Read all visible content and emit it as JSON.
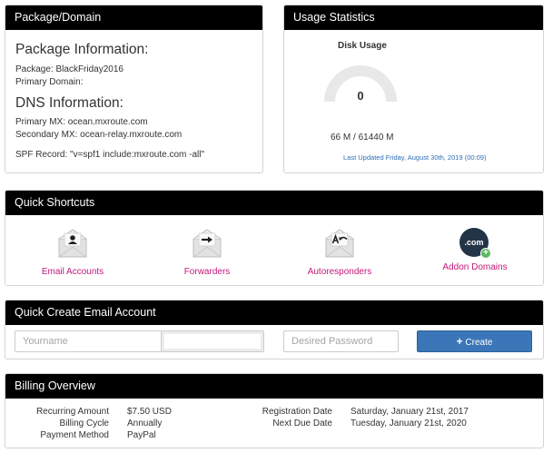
{
  "package_panel": {
    "title": "Package/Domain",
    "package_info_heading": "Package Information:",
    "package_label": "Package:",
    "package_value": "BlackFriday2016",
    "primary_domain_label": "Primary Domain:",
    "primary_domain_value": "",
    "dns_heading": "DNS Information:",
    "primary_mx_label": "Primary MX:",
    "primary_mx_value": "ocean.mxroute.com",
    "secondary_mx_label": "Secondary MX:",
    "secondary_mx_value": "ocean-relay.mxroute.com",
    "spf_label": "SPF Record:",
    "spf_value": "\"v=spf1 include:mxroute.com -all\""
  },
  "usage_panel": {
    "title": "Usage Statistics",
    "disk_title": "Disk Usage",
    "gauge_value": "0",
    "gauge_fraction": 0,
    "usage_text": "66 M / 61440 M",
    "last_updated": "Last Updated Friday, August 30th, 2019 (00:09)"
  },
  "shortcuts_panel": {
    "title": "Quick Shortcuts",
    "items": [
      {
        "label": "Email Accounts",
        "icon": "email-accounts-icon"
      },
      {
        "label": "Forwarders",
        "icon": "forwarders-icon"
      },
      {
        "label": "Autoresponders",
        "icon": "autoresponders-icon"
      },
      {
        "label": "Addon Domains",
        "icon": "addon-domains-icon",
        "badge_text": ".com"
      }
    ]
  },
  "create_panel": {
    "title": "Quick Create Email Account",
    "username_placeholder": "Yourname",
    "domain_value": "",
    "password_placeholder": "Desired Password",
    "create_label": "Create",
    "create_icon": "plus-icon"
  },
  "billing_panel": {
    "title": "Billing Overview",
    "left": [
      {
        "label": "Recurring Amount",
        "value": "$7.50 USD"
      },
      {
        "label": "Billing Cycle",
        "value": "Annually"
      },
      {
        "label": "Payment Method",
        "value": "PayPal"
      }
    ],
    "right": [
      {
        "label": "Registration Date",
        "value": "Saturday, January 21st, 2017"
      },
      {
        "label": "Next Due Date",
        "value": "Tuesday, January 21st, 2020"
      }
    ]
  },
  "colors": {
    "header_bg": "#000000",
    "link_pink": "#c2187a",
    "button_blue": "#3a76b8",
    "updated_blue": "#2f6db3",
    "badge_green": "#5cb85c"
  }
}
